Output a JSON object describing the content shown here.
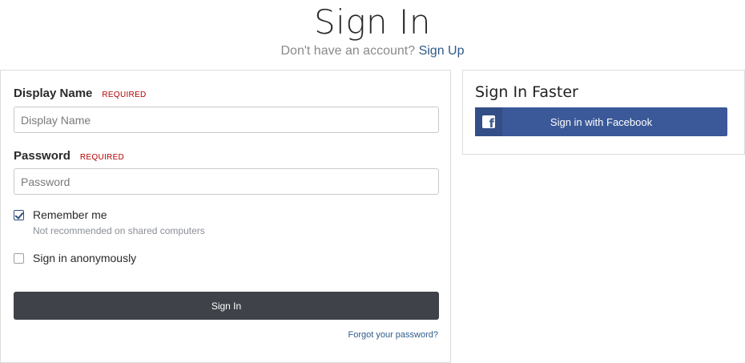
{
  "header": {
    "title": "Sign In",
    "subtitle_text": "Don't have an account?",
    "signup_link": "Sign Up"
  },
  "login": {
    "display_name": {
      "label": "Display Name",
      "required": "REQUIRED",
      "placeholder": "Display Name",
      "value": ""
    },
    "password": {
      "label": "Password",
      "required": "REQUIRED",
      "placeholder": "Password",
      "value": ""
    },
    "remember_me": {
      "label": "Remember me",
      "hint": "Not recommended on shared computers",
      "checked": true
    },
    "anonymous": {
      "label": "Sign in anonymously",
      "checked": false
    },
    "submit_label": "Sign In",
    "forgot_link": "Forgot your password?"
  },
  "faster": {
    "title": "Sign In Faster",
    "facebook_label": "Sign in with Facebook",
    "facebook_icon": "facebook-icon"
  },
  "colors": {
    "link": "#2f5a8a",
    "required": "#b30000",
    "primary_button": "#3f4248",
    "facebook": "#3b5998"
  }
}
